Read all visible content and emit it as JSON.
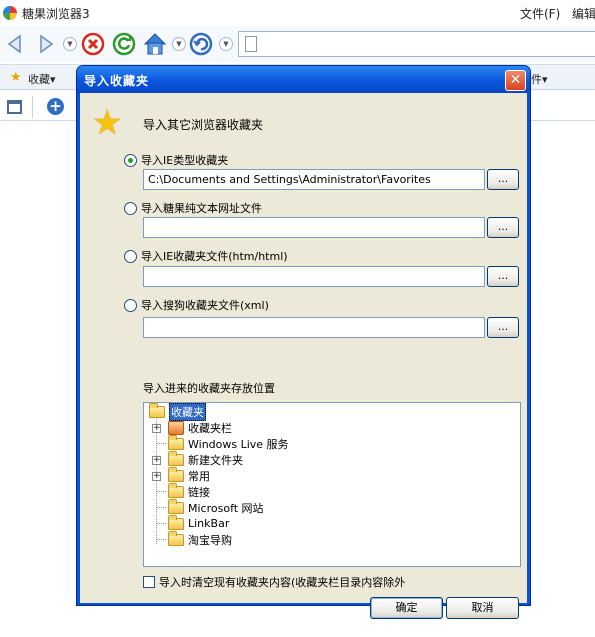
{
  "browser": {
    "title": "糖果浏览器3",
    "menu_file": "文件(F)",
    "menu_edit": "编辑",
    "favorites_label": "收藏▾",
    "favbar_right": "件▾"
  },
  "dialog": {
    "title": "导入收藏夹",
    "close_glyph": "✕",
    "header": "导入其它浏览器收藏夹",
    "options": [
      {
        "label": "导入IE类型收藏夹",
        "checked": true,
        "path": "C:\\Documents and Settings\\Administrator\\Favorites"
      },
      {
        "label": "导入糖果纯文本网址文件",
        "checked": false,
        "path": ""
      },
      {
        "label": "导入IE收藏夹文件(htm/html)",
        "checked": false,
        "path": ""
      },
      {
        "label": "导入搜狗收藏夹文件(xml)",
        "checked": false,
        "path": ""
      }
    ],
    "browse_label": "...",
    "location_label": "导入进来的收藏夹存放位置",
    "tree": [
      {
        "label": "收藏夹",
        "selected": true
      },
      {
        "label": "收藏夹栏",
        "expandable": true
      },
      {
        "label": "Windows Live 服务"
      },
      {
        "label": "新建文件夹",
        "expandable": true
      },
      {
        "label": "常用",
        "expandable": true
      },
      {
        "label": "链接"
      },
      {
        "label": "Microsoft 网站"
      },
      {
        "label": "LinkBar"
      },
      {
        "label": "淘宝导购"
      }
    ],
    "clear_checkbox_label": "导入时清空现有收藏夹内容(收藏夹栏目录内容除外",
    "ok_label": "确定",
    "cancel_label": "取消"
  }
}
